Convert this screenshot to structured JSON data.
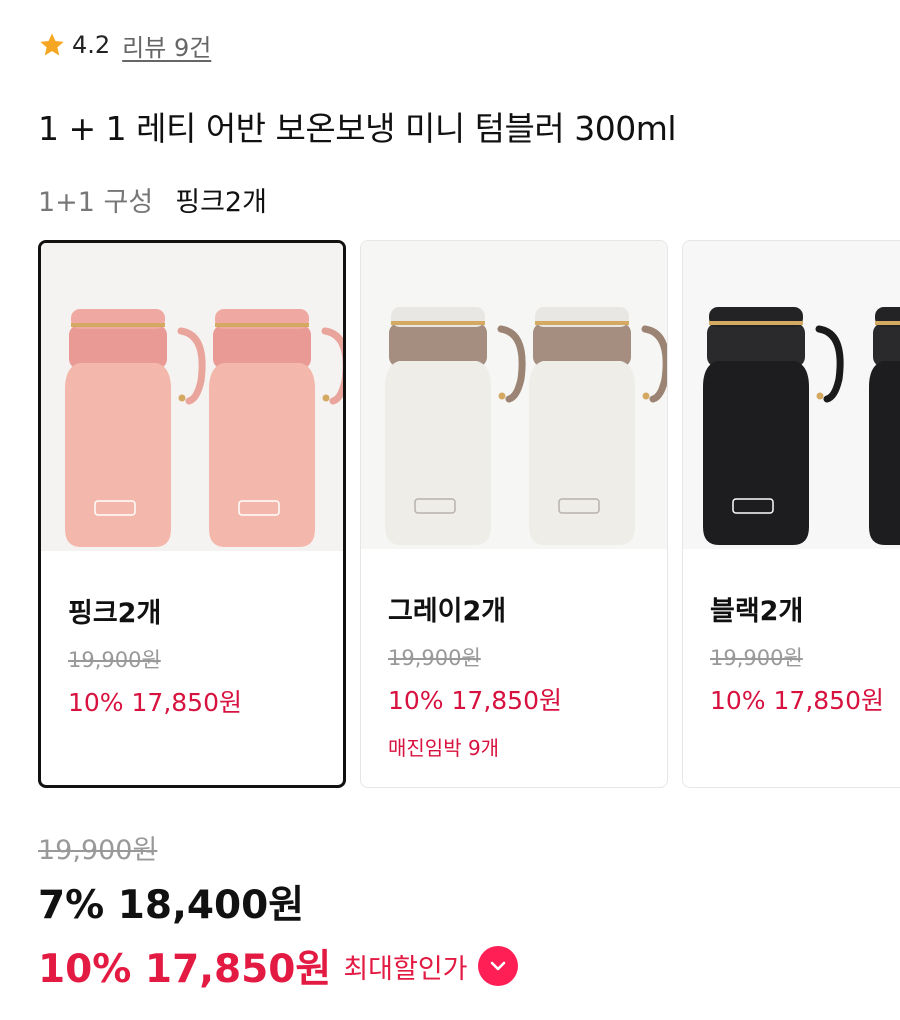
{
  "rating": {
    "score": "4.2",
    "review_label": "리뷰 9건",
    "star_icon": "star-icon",
    "star_color": "#f5a623"
  },
  "product": {
    "title": "1 + 1 레티 어반 보온보냉 미니 텀블러 300ml"
  },
  "option": {
    "label": "1+1 구성",
    "selected_value": "핑크2개"
  },
  "options": [
    {
      "name": "핑크2개",
      "original_price": "19,900원",
      "sale_price": "10% 17,850원",
      "stock_note": "",
      "selected": true,
      "body_color": "#f4b7ac",
      "cap_color": "#e99a95",
      "handle_color": "#e9a49c"
    },
    {
      "name": "그레이2개",
      "original_price": "19,900원",
      "sale_price": "10% 17,850원",
      "stock_note": "매진임박 9개",
      "selected": false,
      "body_color": "#f1efea",
      "cap_color": "#a58e7f",
      "handle_color": "#9c8474"
    },
    {
      "name": "블랙2개",
      "original_price": "19,900원",
      "sale_price": "10% 17,850원",
      "stock_note": "",
      "selected": false,
      "body_color": "#1d1d1f",
      "cap_color": "#2a2a2c",
      "handle_color": "#1a1a1a"
    }
  ],
  "pricing": {
    "original": "19,900원",
    "current": "7% 18,400원",
    "max_discount": "10% 17,850원",
    "max_discount_label": "최대할인가",
    "toggle_icon": "chevron-down-icon",
    "accent_color": "#e31b43"
  }
}
